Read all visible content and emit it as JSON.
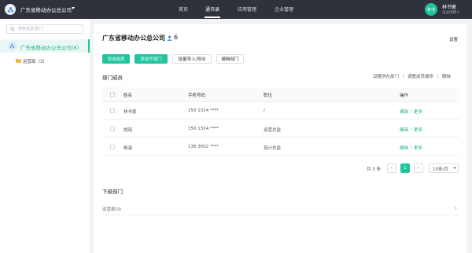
{
  "topbar": {
    "org_name": "广东省移动办公总公司",
    "nav": [
      {
        "label": "首页",
        "active": false
      },
      {
        "label": "通讯录",
        "active": true
      },
      {
        "label": "应用管理",
        "active": false
      },
      {
        "label": "企业管理",
        "active": false
      }
    ],
    "user": {
      "avatar_text": "林书",
      "name": "林书豪",
      "role": "企业创建人"
    },
    "colors": {
      "bar": "#2f323a",
      "avatar": "#20c5a0"
    }
  },
  "sidebar": {
    "search_placeholder": "搜索成员/部门",
    "root_label": "广东省移动办公总公司(6)",
    "children": [
      {
        "label": "运营部（3）"
      }
    ]
  },
  "main": {
    "title": "广东省移动办公总公司",
    "member_count": "6",
    "settings_label": "设置",
    "buttons": {
      "add_member": "添加成员",
      "add_sub_dept": "添加子部门",
      "batch_import": "批量导入/导出",
      "edit_dept": "编辑部门"
    },
    "members_section": {
      "title": "部门成员",
      "actions": [
        "设置所在部门",
        "调整成员顺序",
        "删除"
      ]
    },
    "table": {
      "columns": {
        "name": "姓名",
        "phone": "手机号码",
        "position": "职位",
        "ops": "操作"
      },
      "rows": [
        {
          "name": "林书豪",
          "phone": "150 1324 ****",
          "position": "/",
          "edit": "编辑",
          "more": "更多"
        },
        {
          "name": "姚瑶",
          "phone": "150 1324 ****",
          "position": "运营总监",
          "edit": "编辑",
          "more": "更多"
        },
        {
          "name": "杨涵",
          "phone": "136 3002 ****",
          "position": "设计总监",
          "edit": "编辑",
          "more": "更多"
        }
      ]
    },
    "pagination": {
      "total": "共 3 条",
      "prev": "‹",
      "current_page": "1",
      "next": "›",
      "page_size": "10条/页"
    },
    "sub_depts": {
      "title": "下级部门",
      "items": [
        {
          "label": "运营部(3)"
        }
      ]
    }
  },
  "accent_color": "#20c5a0"
}
